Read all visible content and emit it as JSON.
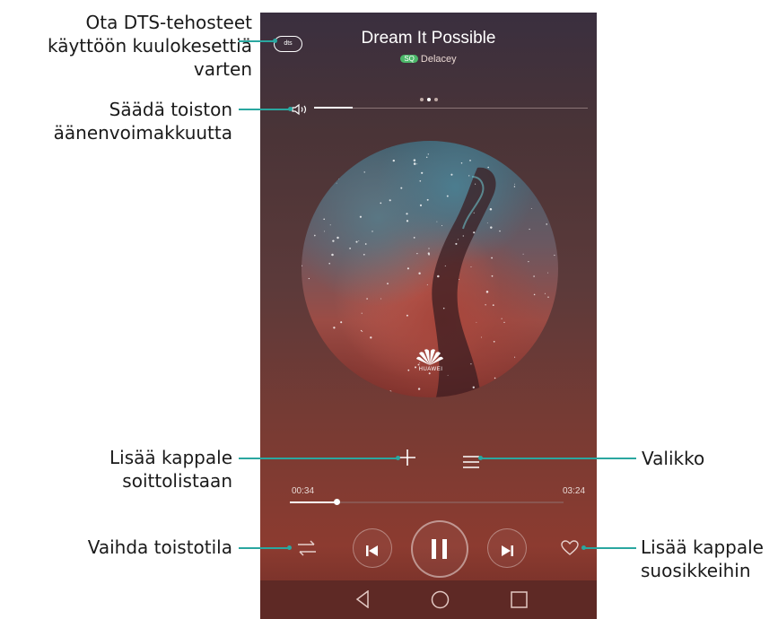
{
  "callouts": {
    "dts": "Ota DTS-tehosteet käyttöön kuulokesettiä varten",
    "dts_lines": [
      "Ota DTS-tehosteet",
      "käyttöön kuulokesettiä",
      "varten"
    ],
    "volume_lines": [
      "Säädä toiston",
      "äänenvoimakkuutta"
    ],
    "add_playlist_lines": [
      "Lisää kappale",
      "soittolistaan"
    ],
    "menu": "Valikko",
    "play_mode": "Vaihda toistotila",
    "favorite_lines": [
      "Lisää kappale",
      "suosikkeihin"
    ]
  },
  "player": {
    "title": "Dream It Possible",
    "artist": "Delacey",
    "quality_badge": "SQ",
    "dts_label": "dts",
    "album_brand": "HUAWEI",
    "elapsed": "00:34",
    "duration": "03:24",
    "progress_fraction": 0.17,
    "volume_fraction": 0.14,
    "page_indicator": {
      "count": 3,
      "active": 2
    }
  },
  "icons": {
    "dts": "dts-icon",
    "volume": "speaker-icon",
    "add": "plus-icon",
    "menu": "menu-icon",
    "play_mode": "shuffle-repeat-icon",
    "previous": "skip-previous-icon",
    "play_pause": "pause-icon",
    "next": "skip-next-icon",
    "favorite": "heart-icon",
    "back": "nav-back-icon",
    "home": "nav-home-icon",
    "recents": "nav-recents-icon"
  },
  "colors": {
    "callout_line": "#2aa7a0",
    "badge": "#4cb86a"
  }
}
